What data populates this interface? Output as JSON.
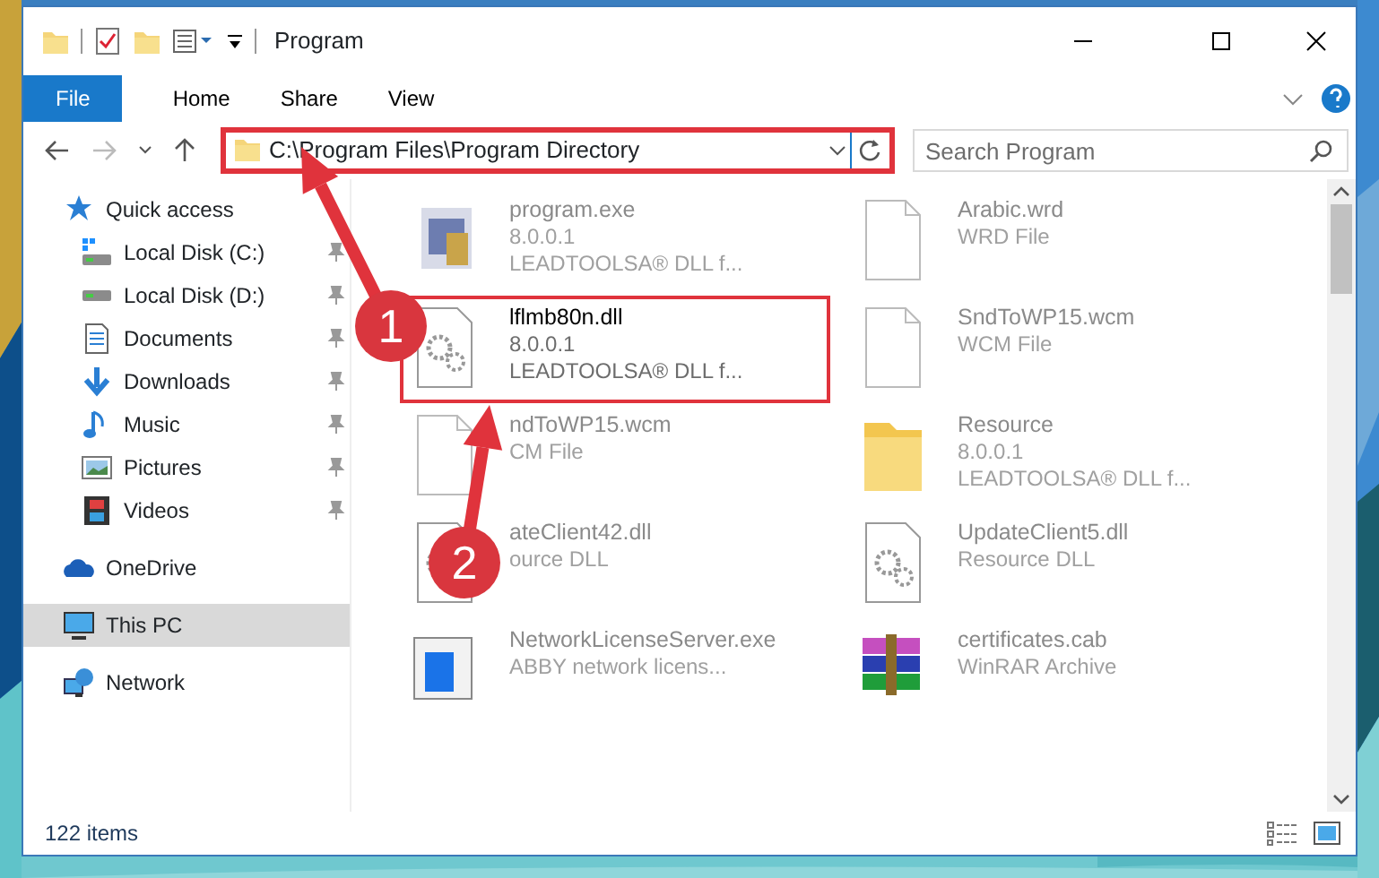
{
  "window": {
    "title": "Program"
  },
  "ribbon_tabs": [
    {
      "label": "File",
      "selected": true
    },
    {
      "label": "Home",
      "selected": false
    },
    {
      "label": "Share",
      "selected": false
    },
    {
      "label": "View",
      "selected": false
    }
  ],
  "address": {
    "path": "C:\\Program Files\\Program Directory",
    "highlighted": true
  },
  "search": {
    "placeholder": "Search Program"
  },
  "nav": [
    {
      "label": "Quick access",
      "kind": "star",
      "pinned": false,
      "selected": false
    },
    {
      "label": "Local Disk (C:)",
      "kind": "disk-c",
      "pinned": true,
      "selected": false
    },
    {
      "label": "Local Disk (D:)",
      "kind": "disk",
      "pinned": true,
      "selected": false
    },
    {
      "label": "Documents",
      "kind": "docs",
      "pinned": true,
      "selected": false
    },
    {
      "label": "Downloads",
      "kind": "download",
      "pinned": true,
      "selected": false
    },
    {
      "label": "Music",
      "kind": "music",
      "pinned": true,
      "selected": false
    },
    {
      "label": "Pictures",
      "kind": "pictures",
      "pinned": true,
      "selected": false
    },
    {
      "label": "Videos",
      "kind": "videos",
      "pinned": true,
      "selected": false
    },
    {
      "label": "OneDrive",
      "kind": "cloud",
      "pinned": false,
      "selected": false
    },
    {
      "label": "This PC",
      "kind": "pc",
      "pinned": false,
      "selected": true
    },
    {
      "label": "Network",
      "kind": "network",
      "pinned": false,
      "selected": false
    }
  ],
  "files": [
    {
      "name": "program.exe",
      "details": [
        "8.0.0.1",
        "LEADTOOLSA® DLL f..."
      ],
      "kind": "exe",
      "blurred": true,
      "highlighted": false
    },
    {
      "name": "Arabic.wrd",
      "details": [
        "WRD File"
      ],
      "kind": "blank",
      "blurred": true,
      "highlighted": false
    },
    {
      "name": "lflmb80n.dll",
      "details": [
        "8.0.0.1",
        "LEADTOOLSA® DLL f..."
      ],
      "kind": "dll",
      "blurred": false,
      "highlighted": true
    },
    {
      "name": "SndToWP15.wcm",
      "details": [
        "WCM File"
      ],
      "kind": "blank",
      "blurred": true,
      "highlighted": false
    },
    {
      "name": "ndToWP15.wcm",
      "details": [
        "CM File"
      ],
      "kind": "blank",
      "blurred": true,
      "highlighted": false
    },
    {
      "name": "Resource",
      "details": [
        "8.0.0.1",
        "LEADTOOLSA® DLL f..."
      ],
      "kind": "folder",
      "blurred": true,
      "highlighted": false
    },
    {
      "name": "ateClient42.dll",
      "details": [
        "ource DLL"
      ],
      "kind": "dll",
      "blurred": true,
      "highlighted": false
    },
    {
      "name": "UpdateClient5.dll",
      "details": [
        "Resource DLL"
      ],
      "kind": "dll",
      "blurred": true,
      "highlighted": false
    },
    {
      "name": "NetworkLicenseServer.exe",
      "details": [
        "ABBY network licens..."
      ],
      "kind": "app",
      "blurred": true,
      "highlighted": false
    },
    {
      "name": "certificates.cab",
      "details": [
        "WinRAR Archive"
      ],
      "kind": "archive",
      "blurred": true,
      "highlighted": false
    }
  ],
  "status_bar": {
    "count": "122 items"
  },
  "annotations": [
    {
      "number": "1"
    },
    {
      "number": "2"
    }
  ]
}
